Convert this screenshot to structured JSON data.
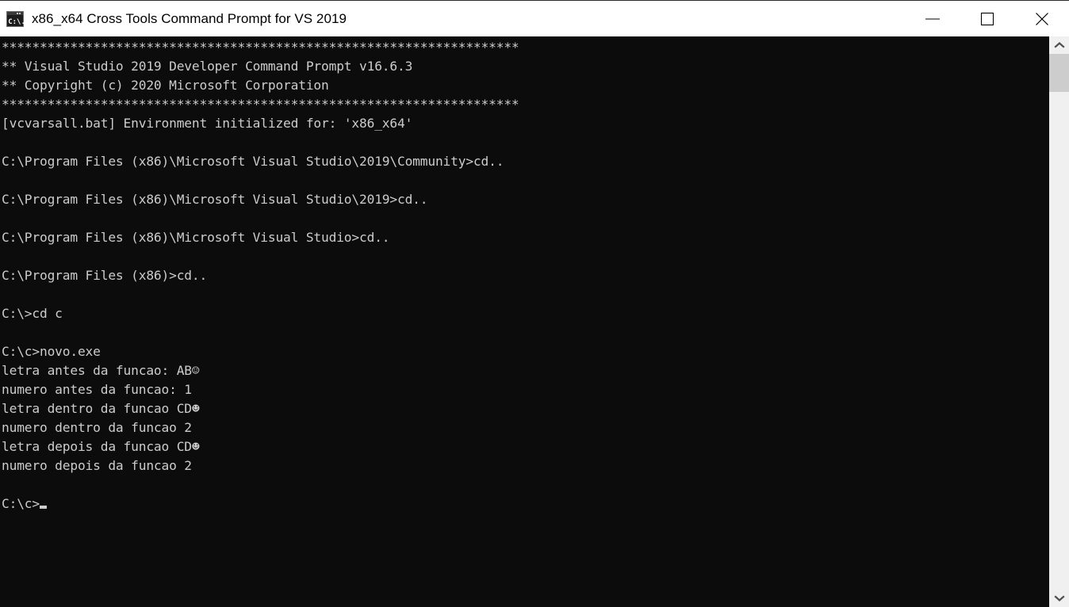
{
  "window": {
    "title": "x86_x64 Cross Tools Command Prompt for VS 2019",
    "icon": "console-window-icon",
    "titlebar_bg": "#ffffff",
    "console_bg": "#0c0c0c",
    "console_fg": "#cccccc",
    "controls": [
      {
        "name": "minimize-button",
        "label": "Minimize",
        "glyph": "minimize-icon"
      },
      {
        "name": "maximize-button",
        "label": "Maximize",
        "glyph": "maximize-icon"
      },
      {
        "name": "close-button",
        "label": "Close",
        "glyph": "close-icon"
      }
    ]
  },
  "console": {
    "lines": [
      "********************************************************************",
      "** Visual Studio 2019 Developer Command Prompt v16.6.3",
      "** Copyright (c) 2020 Microsoft Corporation",
      "********************************************************************",
      "[vcvarsall.bat] Environment initialized for: 'x86_x64'",
      "",
      "C:\\Program Files (x86)\\Microsoft Visual Studio\\2019\\Community>cd..",
      "",
      "C:\\Program Files (x86)\\Microsoft Visual Studio\\2019>cd..",
      "",
      "C:\\Program Files (x86)\\Microsoft Visual Studio>cd..",
      "",
      "C:\\Program Files (x86)>cd..",
      "",
      "C:\\>cd c",
      "",
      "C:\\c>novo.exe",
      "letra antes da funcao: AB☺",
      "numero antes da funcao: 1",
      "letra dentro da funcao CD☻",
      "numero dentro da funcao 2",
      "letra depois da funcao CD☻",
      "numero depois da funcao 2",
      "",
      "C:\\c>"
    ],
    "prompt_last": "C:\\c>",
    "cursor": "block-underscore-cursor"
  },
  "scrollbar": {
    "up_arrow": "chevron-up-icon",
    "down_arrow": "chevron-down-icon",
    "thumb": "scrollbar-thumb",
    "track_color": "#f0f0f0",
    "thumb_color": "#cdcdcd"
  }
}
